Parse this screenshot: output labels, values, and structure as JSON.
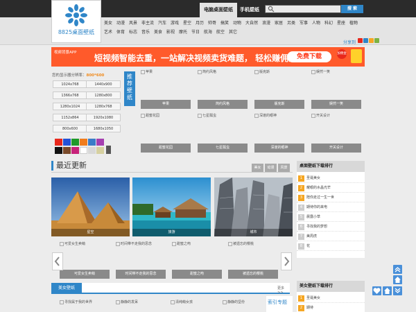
{
  "header": {
    "logo_text": "8825桌面壁纸",
    "nav_tabs": [
      "电脑桌面壁纸",
      "手机壁纸"
    ],
    "search_button": "搜 索",
    "search_placeholder": "",
    "categories_row1": [
      "美女",
      "动漫",
      "风景",
      "非主流",
      "汽车",
      "游戏",
      "星空",
      "月历",
      "帅哥",
      "搞笑",
      "动物",
      "大自然",
      "浪漫",
      "家居",
      "另类",
      "军事",
      "人物",
      "科幻",
      "星座",
      "植物"
    ],
    "categories_row2": [
      "艺术",
      "体育",
      "标志",
      "音乐",
      "美食",
      "影视",
      "摩托",
      "节日",
      "航海",
      "航空",
      "其它"
    ]
  },
  "share_label": "分享到",
  "ad": {
    "small_text": "视频背景APP",
    "headline": "短视频智能去重，一站解决视频卖货难题， 轻松赚佣金",
    "button": "免费下载",
    "badge": "加佣金"
  },
  "resolution": {
    "label": "您的显示器分辨率：",
    "value": "800*600",
    "options": [
      "1024x768",
      "1440x900",
      "1366x768",
      "1280x800",
      "1280x1024",
      "1280x768",
      "1152x864",
      "1920x1080",
      "800x600",
      "1680x1050"
    ]
  },
  "colors": [
    "#e8281c",
    "#2452d6",
    "#1f9a2a",
    "#f07c1c",
    "#3a7cc8",
    "#a53fb0",
    "#111111",
    "#7a4a2a",
    "#c8237a",
    "#ffffff",
    "#d8d8d8",
    "#d6d0a0",
    "#f5e800",
    "#18b8c8",
    "#e8e8e8",
    "#e0e0e0"
  ],
  "recommend": {
    "tag": [
      "推",
      "荐",
      "壁",
      "纸"
    ],
    "items": [
      {
        "thumb": "苹果",
        "caption": "苹果"
      },
      {
        "thumb": "简约风格",
        "caption": "简约风格"
      },
      {
        "thumb": "版克斯",
        "caption": "版克斯"
      },
      {
        "thumb": "娱然一笑",
        "caption": "娱然一笑"
      },
      {
        "thumb": "甜蜜花园",
        "caption": "甜蜜花园"
      },
      {
        "thumb": "七星瓢虫",
        "caption": "七星瓢虫"
      },
      {
        "thumb": "深邃的眼神",
        "caption": "深邃的眼神"
      },
      {
        "thumb": "开关设计",
        "caption": "开关设计"
      }
    ]
  },
  "latest": {
    "title": "最近更新",
    "tabs": [
      "美女",
      "动漫",
      "风景"
    ],
    "photos": [
      "星空",
      "旅游",
      "城市"
    ],
    "thumbs": [
      {
        "thumb": "可爱女生卖萌",
        "caption": "可爱女生卖萌"
      },
      {
        "thumb": "时间带不走我的思念",
        "caption": "时间带不走我的思念"
      },
      {
        "thumb": "甜蜜之吻",
        "caption": "甜蜜之吻"
      },
      {
        "thumb": "被遗忘的樱桃",
        "caption": "被遗忘的樱桃"
      }
    ]
  },
  "bottom": {
    "tab": "美女壁纸",
    "more": "更多>>",
    "thumbs": [
      "寻找属于我的世界",
      "静静的发呆",
      "清纯萌女孩",
      "静静的坚份"
    ],
    "topic": "索引专题"
  },
  "ranking": {
    "title": "桌面壁纸下载排行",
    "items": [
      "圣诞美女",
      "耀眼的水晶光芒",
      "陪你走过一生一世",
      "期待你的来电",
      "晨露小草",
      "寻找我的梦想",
      "美周虎",
      "花"
    ]
  },
  "ranking2": {
    "title": "美女壁纸下载排行",
    "items": [
      "圣诞美女",
      "期待"
    ]
  }
}
